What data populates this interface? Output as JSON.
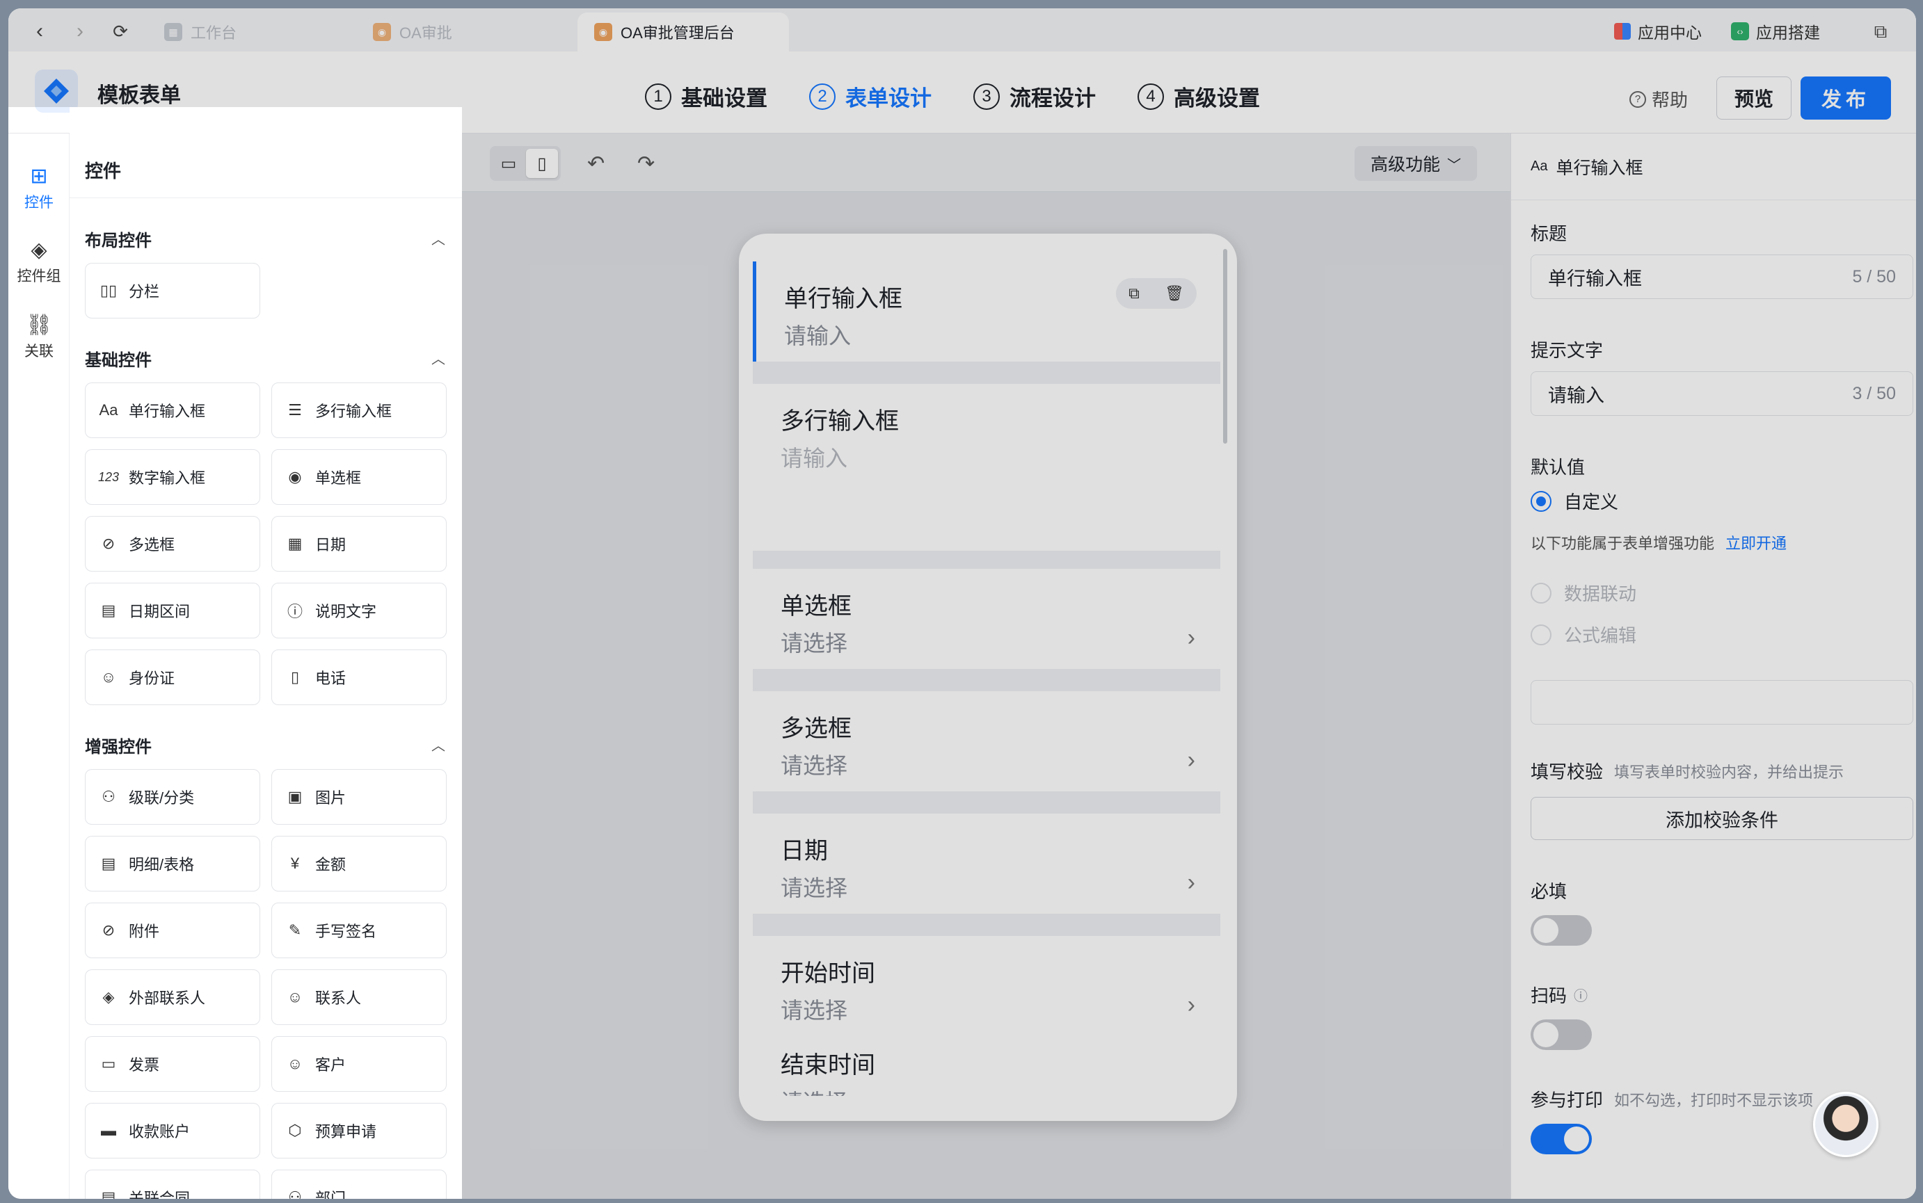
{
  "browser": {
    "tabs": [
      {
        "label": "工作台"
      },
      {
        "label": "OA审批"
      },
      {
        "label": "OA审批管理后台"
      }
    ],
    "app_center": "应用中心",
    "app_builder": "应用搭建"
  },
  "header": {
    "app_title": "模板表单",
    "steps": [
      {
        "num": "1",
        "label": "基础设置"
      },
      {
        "num": "2",
        "label": "表单设计"
      },
      {
        "num": "3",
        "label": "流程设计"
      },
      {
        "num": "4",
        "label": "高级设置"
      }
    ],
    "help": "帮助",
    "preview": "预览",
    "publish": "发布"
  },
  "rail": [
    {
      "label": "控件"
    },
    {
      "label": "控件组"
    },
    {
      "label": "关联"
    }
  ],
  "panel": {
    "title": "控件",
    "groups": [
      {
        "title": "布局控件",
        "items": [
          {
            "icon": "columns-icon",
            "label": "分栏"
          }
        ]
      },
      {
        "title": "基础控件",
        "items": [
          {
            "icon": "text-aa-icon",
            "label": "单行输入框"
          },
          {
            "icon": "multiline-icon",
            "label": "多行输入框"
          },
          {
            "icon": "number-icon",
            "label": "数字输入框"
          },
          {
            "icon": "radio-icon",
            "label": "单选框"
          },
          {
            "icon": "checkbox-icon",
            "label": "多选框"
          },
          {
            "icon": "calendar-icon",
            "label": "日期"
          },
          {
            "icon": "date-range-icon",
            "label": "日期区间"
          },
          {
            "icon": "info-icon",
            "label": "说明文字"
          },
          {
            "icon": "id-card-icon",
            "label": "身份证"
          },
          {
            "icon": "phone-icon",
            "label": "电话"
          }
        ]
      },
      {
        "title": "增强控件",
        "items": [
          {
            "icon": "cascade-icon",
            "label": "级联/分类"
          },
          {
            "icon": "image-icon",
            "label": "图片"
          },
          {
            "icon": "table-icon",
            "label": "明细/表格"
          },
          {
            "icon": "yen-icon",
            "label": "金额"
          },
          {
            "icon": "paperclip-icon",
            "label": "附件"
          },
          {
            "icon": "signature-icon",
            "label": "手写签名"
          },
          {
            "icon": "handshake-icon",
            "label": "外部联系人"
          },
          {
            "icon": "contact-icon",
            "label": "联系人"
          },
          {
            "icon": "invoice-icon",
            "label": "发票"
          },
          {
            "icon": "customer-icon",
            "label": "客户"
          },
          {
            "icon": "account-icon",
            "label": "收款账户"
          },
          {
            "icon": "budget-icon",
            "label": "预算申请"
          },
          {
            "icon": "contract-icon",
            "label": "关联合同"
          },
          {
            "icon": "department-icon",
            "label": "部门"
          }
        ]
      }
    ]
  },
  "canvas": {
    "advanced": "高级功能",
    "fields": [
      {
        "label": "单行输入框",
        "placeholder": "请输入"
      },
      {
        "label": "多行输入框",
        "placeholder": "请输入"
      },
      {
        "label": "单选框",
        "placeholder": "请选择"
      },
      {
        "label": "多选框",
        "placeholder": "请选择"
      },
      {
        "label": "日期",
        "placeholder": "请选择"
      },
      {
        "label": "开始时间",
        "placeholder": "请选择"
      },
      {
        "label": "结束时间",
        "placeholder": "请选择"
      }
    ]
  },
  "props": {
    "header": "单行输入框",
    "title_label": "标题",
    "title_value": "单行输入框",
    "title_count": "5 / 50",
    "hint_label": "提示文字",
    "hint_value": "请输入",
    "hint_count": "3 / 50",
    "default_label": "默认值",
    "opt_custom": "自定义",
    "enhance_note": "以下功能属于表单增强功能",
    "enhance_link": "立即开通",
    "opt_linkage": "数据联动",
    "opt_formula": "公式编辑",
    "validate_label": "填写校验",
    "validate_desc": "填写表单时校验内容，并给出提示",
    "validate_btn": "添加校验条件",
    "required_label": "必填",
    "scan_label": "扫码",
    "print_label": "参与打印",
    "print_desc": "如不勾选，打印时不显示该项",
    "required_on": false,
    "scan_on": false,
    "print_on": true
  }
}
